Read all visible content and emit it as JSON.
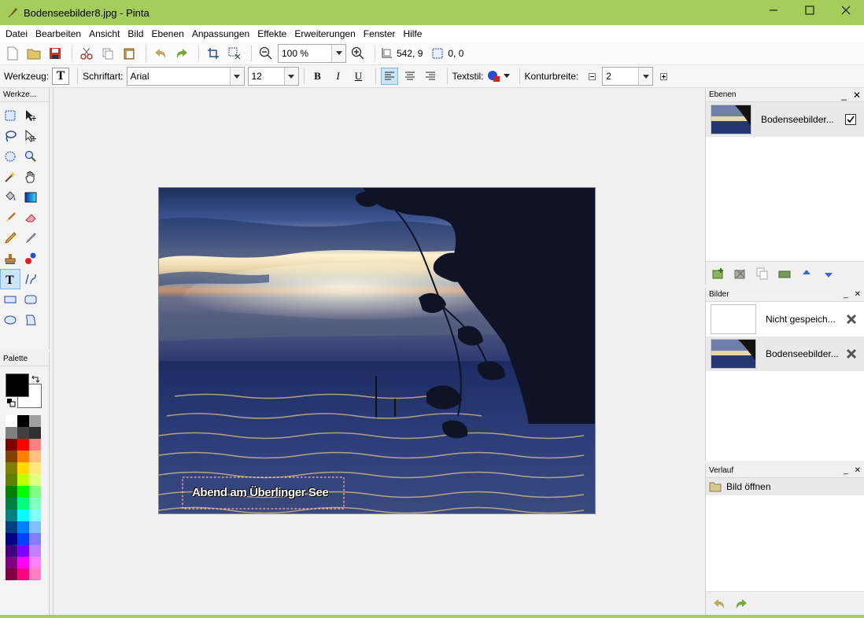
{
  "window": {
    "title": "Bodenseebilder8.jpg - Pinta"
  },
  "menu": [
    "Datei",
    "Bearbeiten",
    "Ansicht",
    "Bild",
    "Ebenen",
    "Anpassungen",
    "Effekte",
    "Erweiterungen",
    "Fenster",
    "Hilfe"
  ],
  "toolbar": {
    "zoom": "100 %",
    "cursor_pos": "542, 9",
    "selection_size": "0, 0"
  },
  "text_toolbar": {
    "tool_label": "Werkzeug:",
    "font_label": "Schriftart:",
    "font_value": "Arial",
    "size_value": "12",
    "bold": "B",
    "italic": "I",
    "underline": "U",
    "textstyle_label": "Textstil:",
    "outline_label": "Konturbreite:",
    "outline_value": "2"
  },
  "panels": {
    "tools_title": "Werkze...",
    "palette_title": "Palette",
    "layers_title": "Ebenen",
    "images_title": "Bilder",
    "history_title": "Verlauf"
  },
  "layers": [
    {
      "name": "Bodenseebilder...",
      "visible": true
    }
  ],
  "images": [
    {
      "name": "Nicht gespeich..."
    },
    {
      "name": "Bodenseebilder..."
    }
  ],
  "history": [
    {
      "name": "Bild öffnen"
    }
  ],
  "canvas": {
    "text": "Abend am Überlinger See"
  },
  "colors": {
    "titlebar": "#a4cd5c",
    "primary": "#000000",
    "secondary": "#ffffff"
  },
  "palette_colors": [
    "#ffffff",
    "#000000",
    "#a0a0a0",
    "#808080",
    "#404040",
    "#303030",
    "#800000",
    "#ff0000",
    "#ff8080",
    "#804000",
    "#ff8000",
    "#ffc080",
    "#808000",
    "#ffd800",
    "#ffe880",
    "#608000",
    "#c0ff00",
    "#e0ff80",
    "#008000",
    "#00ff00",
    "#80ff80",
    "#008040",
    "#00ff80",
    "#80ffc0",
    "#008080",
    "#00ffff",
    "#80ffff",
    "#004080",
    "#0080ff",
    "#80c0ff",
    "#000080",
    "#0040ff",
    "#8080ff",
    "#400080",
    "#8000ff",
    "#c080ff",
    "#800080",
    "#ff00ff",
    "#ff80ff",
    "#800040",
    "#ff0080",
    "#ff80c0"
  ]
}
